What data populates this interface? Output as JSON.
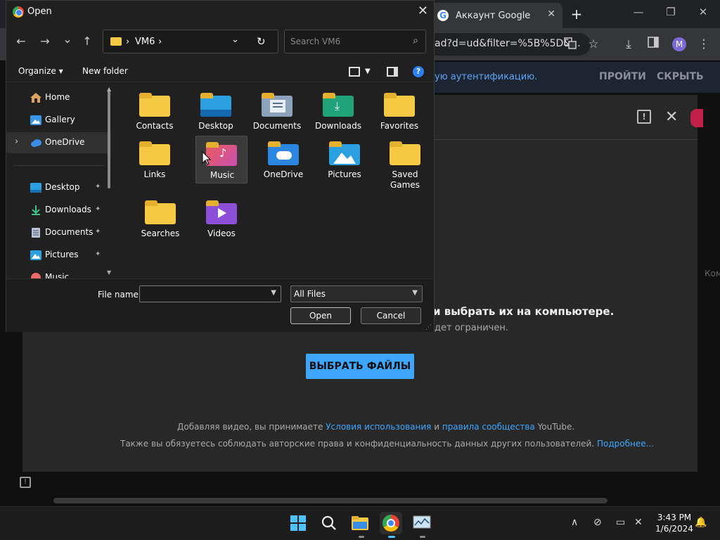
{
  "browser": {
    "tab_title": "Аккаунт Google",
    "tab_close": "✕",
    "new_tab": "+",
    "url": "ad?d=ud&filter=%5B%5D&...",
    "avatar_letter": "M",
    "min": "—",
    "restore": "❐",
    "close": "✕"
  },
  "banner": {
    "text": "ую аутентификацию.",
    "login": "ПРОЙТИ",
    "hide": "СКРЫТЬ"
  },
  "youtube": {
    "drag_text": "и выбрать их на компьютере.",
    "limit_text": "дет ограничен.",
    "select_button": "ВЫБРАТЬ ФАЙЛЫ",
    "terms_prefix": "Добавляя видео, вы принимаете ",
    "terms_link": "Условия использования",
    "terms_and": " и ",
    "community_link": "правила сообщества",
    "terms_suffix": " YouTube.",
    "rights_text": "Также вы обязуетесь соблюдать авторские права и конфиденциальность данных других пользователей. ",
    "more_link": "Подробнее...",
    "side_text": "Ком"
  },
  "dialog": {
    "title": "Open",
    "close": "✕",
    "back": "←",
    "forward": "→",
    "recent": "⌄",
    "up": "↑",
    "crumb_sep": "›",
    "crumb": "VM6",
    "addr_dropdown": "⌄",
    "refresh": "↻",
    "search_placeholder": "Search VM6",
    "organize": "Organize",
    "new_folder": "New folder",
    "help": "?",
    "nav": [
      {
        "label": "Home",
        "icon": "home-icon"
      },
      {
        "label": "Gallery",
        "icon": "gallery-icon"
      },
      {
        "label": "OneDrive",
        "icon": "onedrive-icon"
      },
      {
        "label": "Desktop",
        "icon": "desktop-icon"
      },
      {
        "label": "Downloads",
        "icon": "download-icon"
      },
      {
        "label": "Documents",
        "icon": "documents-icon"
      },
      {
        "label": "Pictures",
        "icon": "pictures-icon"
      },
      {
        "label": "Music",
        "icon": "music-icon"
      }
    ],
    "pin": "📌",
    "expand": "›",
    "files": [
      {
        "label": "Contacts",
        "icon": "folder-icon"
      },
      {
        "label": "Desktop",
        "icon": "desktop-folder-icon"
      },
      {
        "label": "Documents",
        "icon": "documents-folder-icon"
      },
      {
        "label": "Downloads",
        "icon": "downloads-folder-icon"
      },
      {
        "label": "Favorites",
        "icon": "folder-icon"
      },
      {
        "label": "Links",
        "icon": "folder-icon"
      },
      {
        "label": "Music",
        "icon": "music-folder-icon"
      },
      {
        "label": "OneDrive",
        "icon": "onedrive-folder-icon"
      },
      {
        "label": "Pictures",
        "icon": "pictures-folder-icon"
      },
      {
        "label": "Saved Games",
        "icon": "folder-icon"
      },
      {
        "label": "Searches",
        "icon": "folder-icon"
      },
      {
        "label": "Videos",
        "icon": "videos-folder-icon"
      }
    ],
    "file_name_label": "File name:",
    "file_name_value": "",
    "file_type": "All Files",
    "open_button": "Open",
    "cancel_button": "Cancel"
  },
  "taskbar": {
    "time": "3:43 PM",
    "date": "1/6/2024"
  },
  "colors": {
    "accent": "#3ea6ff",
    "folder": "#f5c944"
  }
}
